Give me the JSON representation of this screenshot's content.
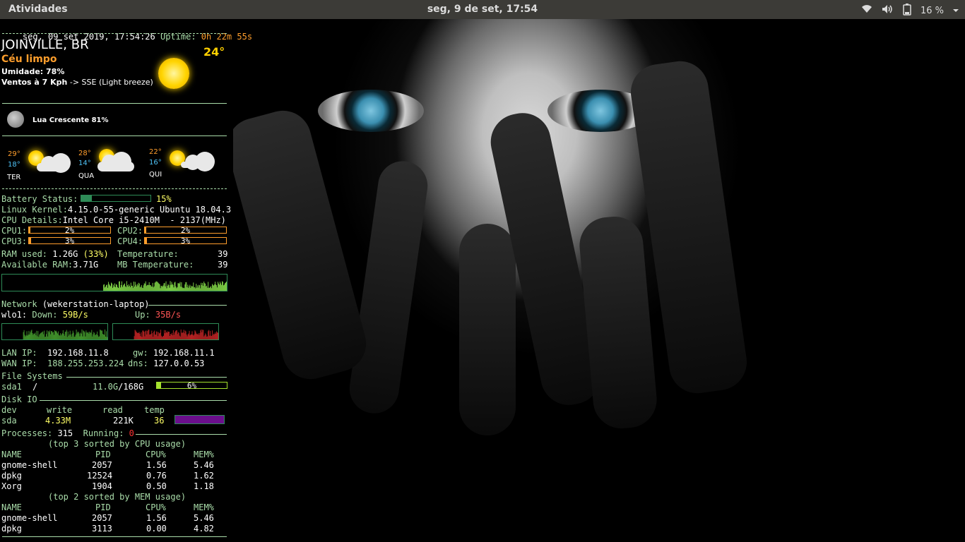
{
  "topbar": {
    "activities": "Atividades",
    "clock": "seg,  9 de set, 17:54",
    "battery_pct": "16 %",
    "icons": [
      "wifi-icon",
      "volume-icon",
      "battery-icon",
      "dropdown-arrow-icon"
    ]
  },
  "conky": {
    "datetime": "seg, 09 set 2019, 17:54:26",
    "uptime_label": "Uptime:",
    "uptime_value": "0h 22m 55s",
    "weather": {
      "city": "JOINVILLE, BR",
      "condition": "Céu limpo",
      "humidity": "Umidade: 78%",
      "wind_label": "Ventos à 7 Kph",
      "wind_dir": "-> SSE (Light breeze)",
      "temp": "24°",
      "moon": "Lua Crescente 81%",
      "forecast": [
        {
          "hi": "29°",
          "lo": "18°",
          "day": "TER"
        },
        {
          "hi": "28°",
          "lo": "14°",
          "day": "QUA"
        },
        {
          "hi": "22°",
          "lo": "16°",
          "day": "QUI"
        }
      ]
    },
    "battery_label": "Battery Status:",
    "battery_value": "15%",
    "battery_fraction": 0.15,
    "kernel_label": "Linux Kernel:",
    "kernel_value": "4.15.0-55-generic Ubuntu 18.04.3",
    "cpu_label": "CPU Details:",
    "cpu_value": "Intel Core i5-2410M  - 2137(MHz)",
    "cpus": [
      {
        "label": "CPU1:",
        "pct": "2%",
        "fraction": 0.02
      },
      {
        "label": "CPU2:",
        "pct": "2%",
        "fraction": 0.02
      },
      {
        "label": "CPU3:",
        "pct": "3%",
        "fraction": 0.03
      },
      {
        "label": "CPU4:",
        "pct": "3%",
        "fraction": 0.03
      }
    ],
    "ram_label": "RAM used:",
    "ram_value": "1.26G",
    "ram_pct": "(33%)",
    "temp_label": "Temperature:",
    "temp_value": "39",
    "avail_label": "Available RAM:",
    "avail_value": "3.71G",
    "mbtemp_label": "MB Temperature:",
    "mbtemp_value": "39",
    "network_label": "Network",
    "hostname": "(wekerstation-laptop)",
    "iface": "wlo1:",
    "down_label": "Down:",
    "down_value": "59B/s",
    "up_label": "Up:",
    "up_value": "35B/s",
    "lan_label": "LAN IP:",
    "lan_value": "192.168.11.8",
    "gw_label": "gw:",
    "gw_value": "192.168.11.1",
    "wan_label": "WAN IP:",
    "wan_value": "188.255.253.224",
    "dns_label": "dns:",
    "dns_value": "127.0.0.53",
    "fs_header": "File Systems",
    "fs_dev": "sda1",
    "fs_mount": "/",
    "fs_used": "11.0G",
    "fs_total": "/168G",
    "fs_pct": "6%",
    "fs_fraction": 0.06,
    "diskio_header": "Disk IO",
    "diskio_cols": [
      "dev",
      "write",
      "read",
      "temp"
    ],
    "diskio_row": {
      "dev": "sda",
      "write": "4.33M",
      "read": "221K",
      "temp": "36"
    },
    "processes_label": "Processes:",
    "processes_value": "315",
    "running_label": "Running:",
    "running_value": "0",
    "top_cpu_title": "(top 3 sorted by CPU usage)",
    "top_mem_title": "(top 2 sorted by MEM usage)",
    "table_cols": [
      "NAME",
      "PID",
      "CPU%",
      "MEM%"
    ],
    "top_cpu": [
      {
        "name": "gnome-shell",
        "pid": "2057",
        "cpu": "1.56",
        "mem": "5.46"
      },
      {
        "name": "dpkg",
        "pid": "12524",
        "cpu": "0.76",
        "mem": "1.62"
      },
      {
        "name": "Xorg",
        "pid": "1904",
        "cpu": "0.50",
        "mem": "1.18"
      }
    ],
    "top_mem": [
      {
        "name": "gnome-shell",
        "pid": "2057",
        "cpu": "1.56",
        "mem": "5.46"
      },
      {
        "name": "dpkg",
        "pid": "3113",
        "cpu": "0.00",
        "mem": "4.82"
      }
    ]
  }
}
